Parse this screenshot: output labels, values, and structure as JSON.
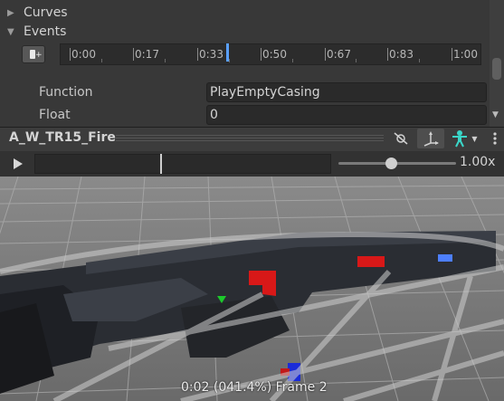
{
  "inspector": {
    "foldouts": [
      {
        "label": "Curves",
        "expanded": false
      },
      {
        "label": "Events",
        "expanded": true
      }
    ],
    "ruler_ticks": [
      "0:00",
      "0:17",
      "0:33",
      "0:50",
      "0:67",
      "0:83",
      "1:00"
    ],
    "fields": [
      {
        "label": "Function",
        "value": "PlayEmptyCasing"
      },
      {
        "label": "Float",
        "value": "0"
      }
    ]
  },
  "preview": {
    "clip_name": "A_W_TR15_Fire",
    "speed": "1.00x",
    "speed_fraction": 0.45,
    "playhead_fraction": 0.424,
    "frame_info": "0:02 (041.4%) Frame 2"
  },
  "colors": {
    "accent_blue": "#5aa0ff",
    "avatar_cyan": "#3ad6c8"
  }
}
